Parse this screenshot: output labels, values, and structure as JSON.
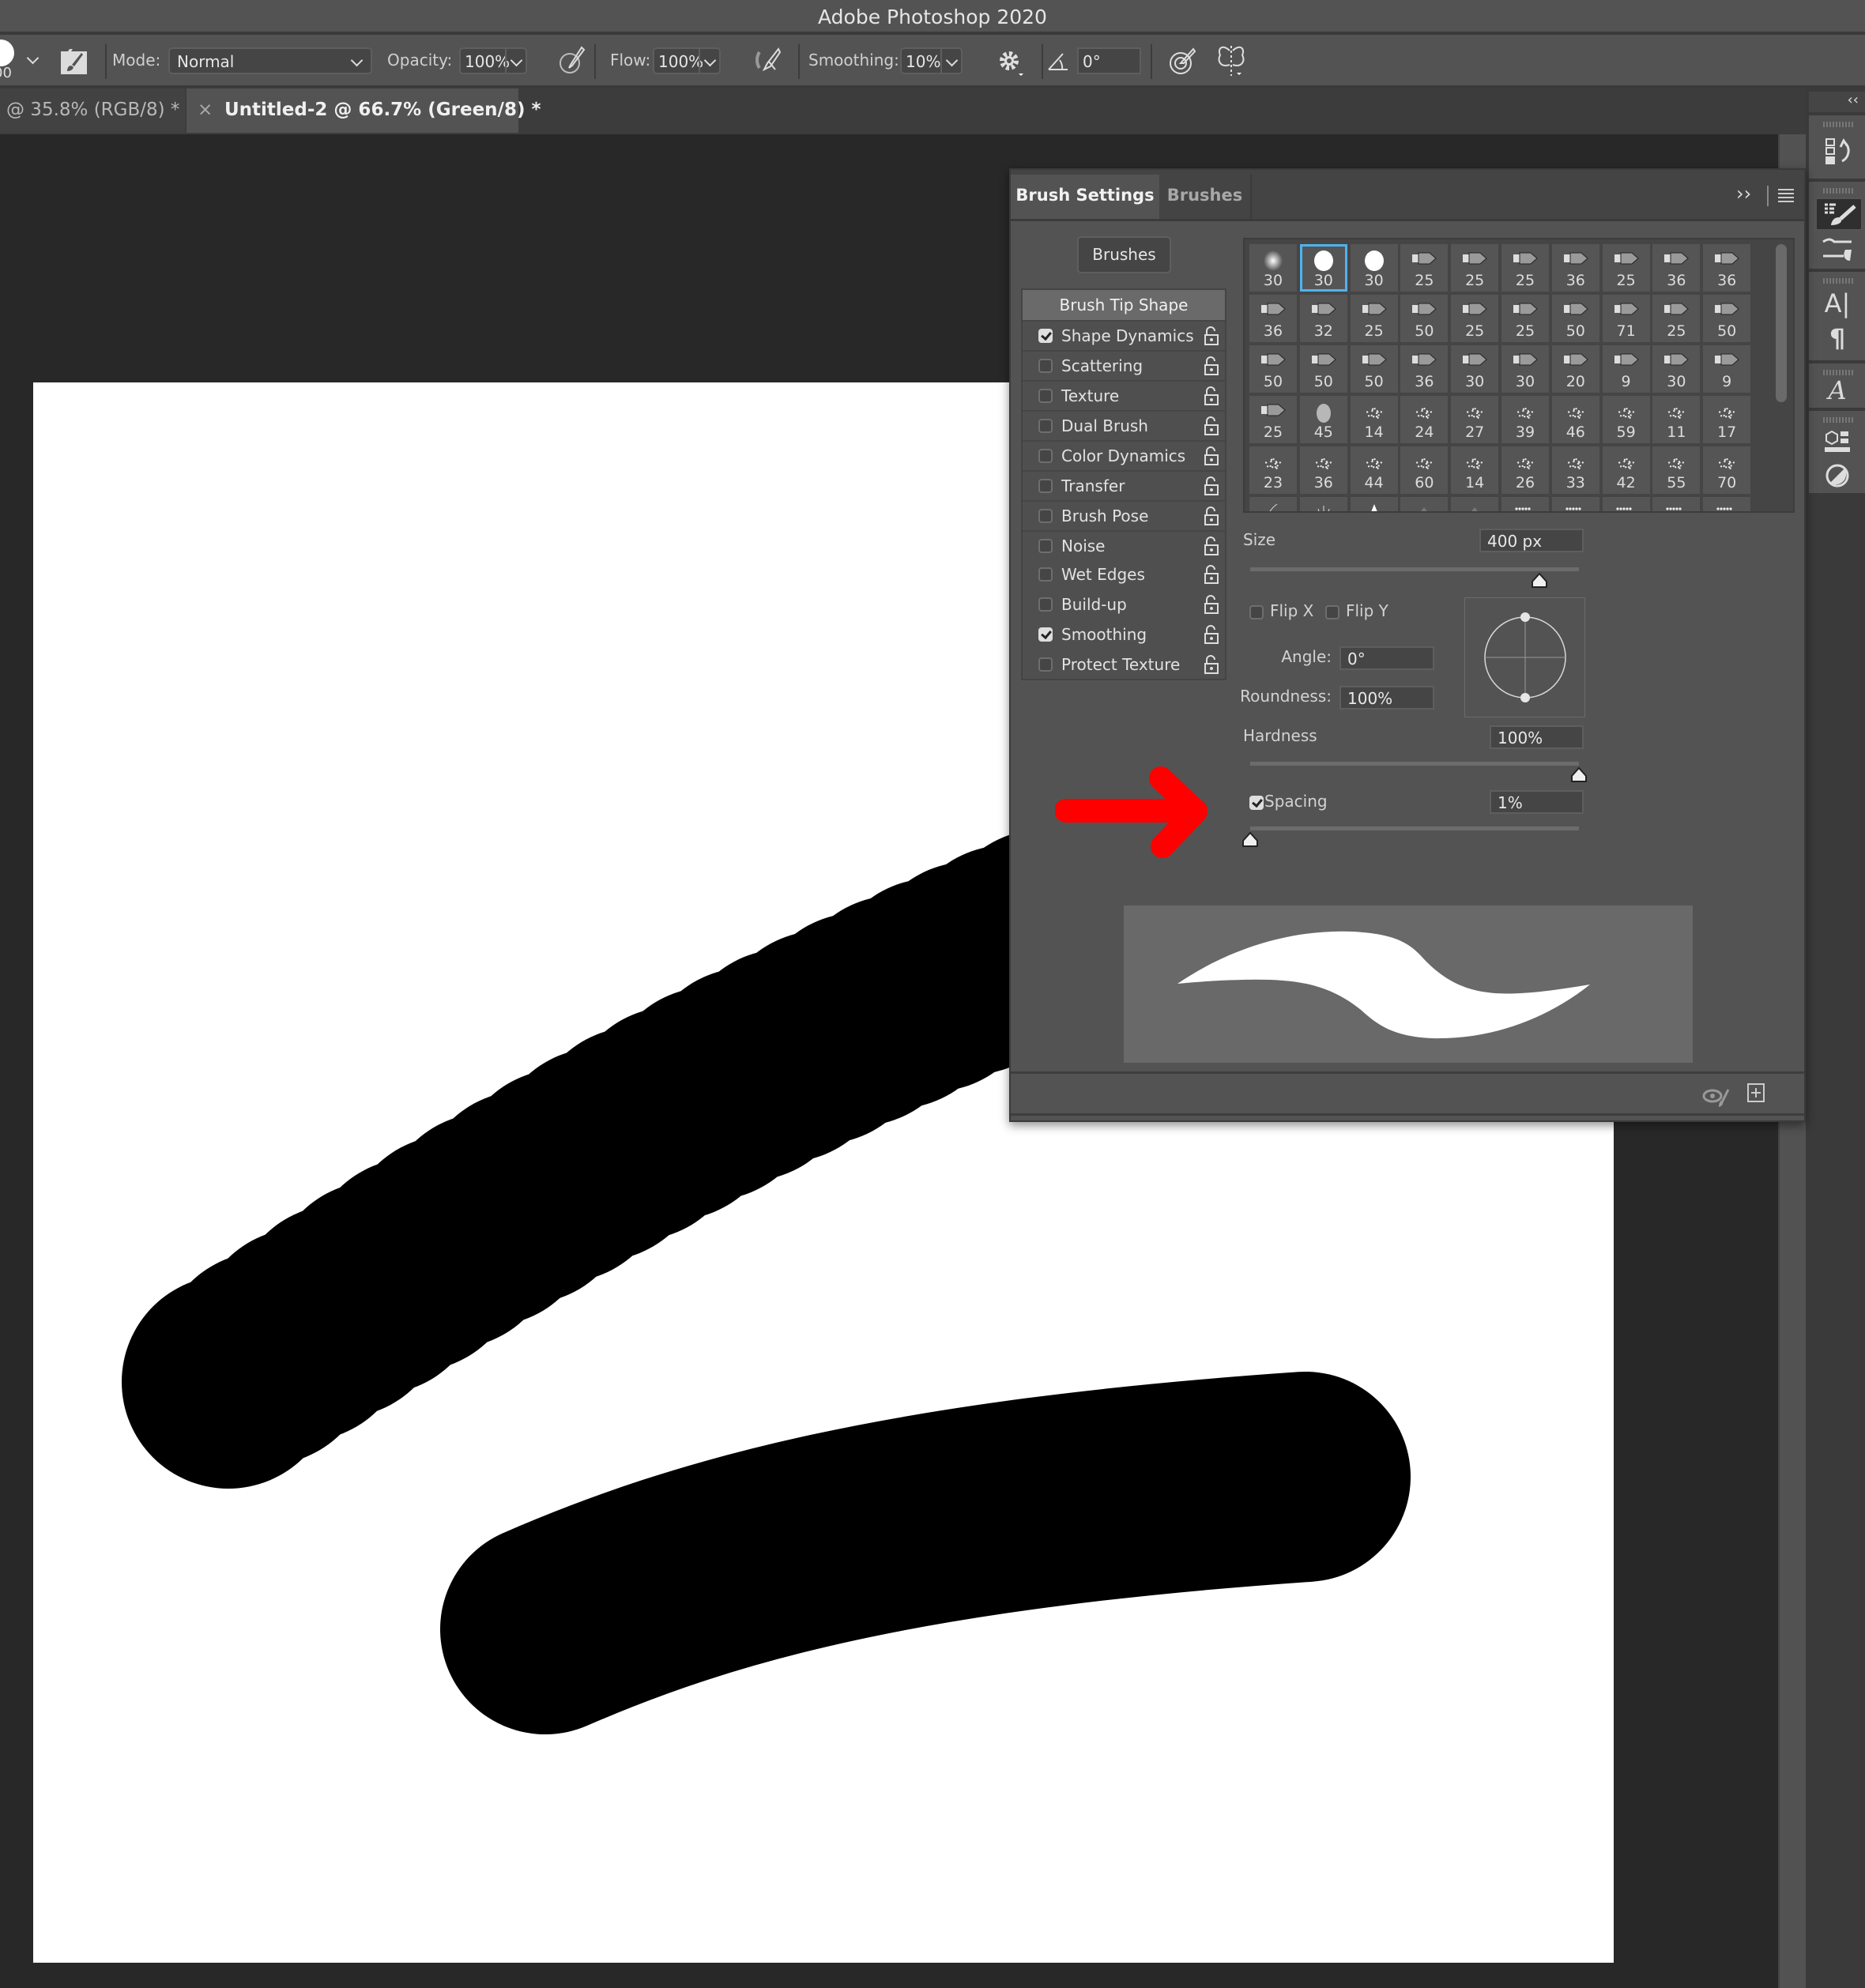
{
  "app": {
    "title": "Adobe Photoshop 2020"
  },
  "options_bar": {
    "brush_size_fragment": "00",
    "mode_label": "Mode:",
    "mode_value": "Normal",
    "opacity_label": "Opacity:",
    "opacity_value": "100%",
    "flow_label": "Flow:",
    "flow_value": "100%",
    "smoothing_label": "Smoothing:",
    "smoothing_value": "10%",
    "angle_value": "0°",
    "icons": [
      "brush-preset-icon",
      "toggle-brush-settings-icon",
      "pressure-opacity-icon",
      "airbrush-icon",
      "smoothing-options-gear-icon",
      "angle-icon",
      "pressure-size-icon",
      "symmetry-butterfly-icon"
    ]
  },
  "document_tabs": [
    {
      "label": "@ 35.8% (RGB/8) *",
      "active": false
    },
    {
      "label": "Untitled-2 @ 66.7% (Green/8) *",
      "active": true,
      "close": "×"
    }
  ],
  "brush_panel": {
    "tabs": [
      {
        "label": "Brush Settings",
        "active": true
      },
      {
        "label": "Brushes",
        "active": false
      }
    ],
    "brushes_button": "Brushes",
    "options_header": "Brush Tip Shape",
    "options": [
      {
        "label": "Shape Dynamics",
        "checked": true
      },
      {
        "label": "Scattering",
        "checked": false
      },
      {
        "label": "Texture",
        "checked": false
      },
      {
        "label": "Dual Brush",
        "checked": false
      },
      {
        "label": "Color Dynamics",
        "checked": false
      },
      {
        "label": "Transfer",
        "checked": false
      },
      {
        "label": "Brush Pose",
        "checked": false
      },
      {
        "label": "Noise",
        "checked": false
      },
      {
        "label": "Wet Edges",
        "checked": false
      },
      {
        "label": "Build-up",
        "checked": false
      },
      {
        "label": "Smoothing",
        "checked": true
      },
      {
        "label": "Protect Texture",
        "checked": false
      }
    ],
    "brush_tips": [
      [
        "30",
        "30",
        "30",
        "25",
        "25",
        "25",
        "36",
        "25",
        "36",
        "36"
      ],
      [
        "36",
        "32",
        "25",
        "50",
        "25",
        "25",
        "50",
        "71",
        "25",
        "50"
      ],
      [
        "50",
        "50",
        "50",
        "36",
        "30",
        "30",
        "20",
        "9",
        "30",
        "9"
      ],
      [
        "25",
        "45",
        "14",
        "24",
        "27",
        "39",
        "46",
        "59",
        "11",
        "17"
      ],
      [
        "23",
        "36",
        "44",
        "60",
        "14",
        "26",
        "33",
        "42",
        "55",
        "70"
      ]
    ],
    "selected_tip": {
      "row": 0,
      "col": 1
    },
    "size_label": "Size",
    "size_value": "400 px",
    "size_slider_fraction": 0.88,
    "flip_x_label": "Flip X",
    "flip_x": false,
    "flip_y_label": "Flip Y",
    "flip_y": false,
    "angle_label": "Angle:",
    "angle_value": "0°",
    "roundness_label": "Roundness:",
    "roundness_value": "100%",
    "hardness_label": "Hardness",
    "hardness_value": "100%",
    "hardness_slider_fraction": 1.0,
    "spacing_label": "Spacing",
    "spacing_checked": true,
    "spacing_value": "1%",
    "spacing_slider_fraction": 0.0,
    "footer_icons": [
      "toggle-live-tip-preview-icon",
      "create-new-brush-icon"
    ]
  },
  "annotation": {
    "type": "arrow",
    "color": "#ff0000",
    "points_to": "Spacing"
  },
  "colors": {
    "accent_selection": "#4fb3ee",
    "panel_bg": "#535353",
    "canvas": "#ffffff",
    "paint": "#000000"
  }
}
